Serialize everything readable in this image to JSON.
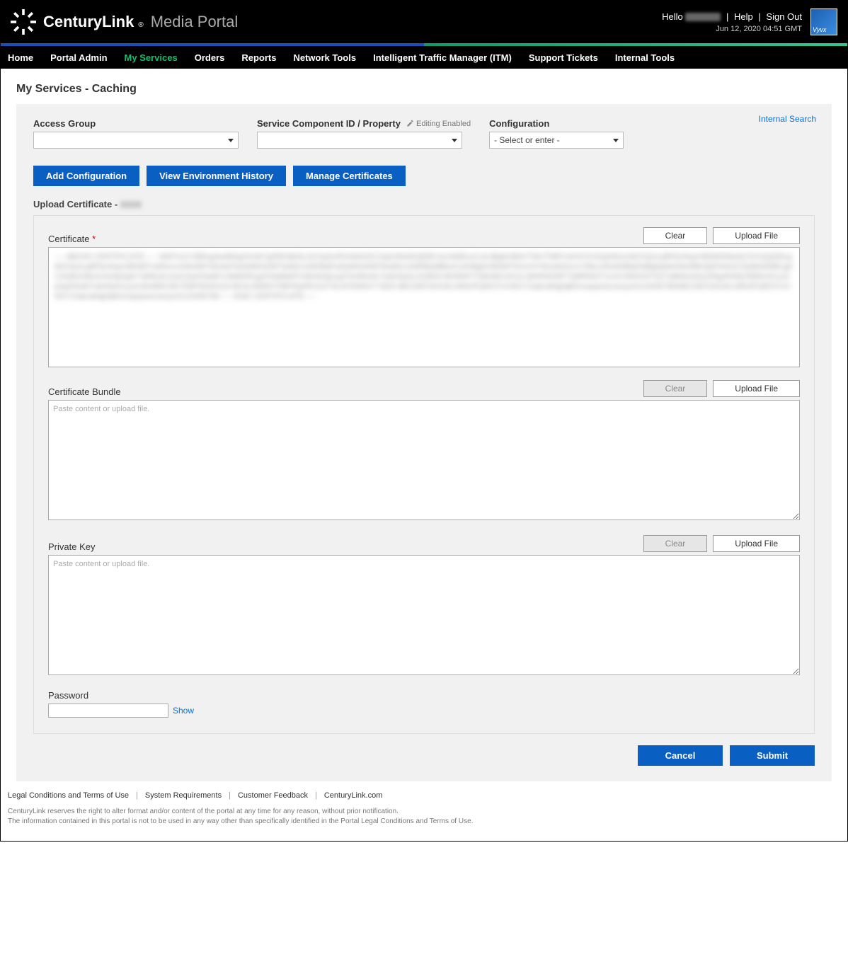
{
  "header": {
    "brand_bold": "CenturyLink",
    "brand_reg": "®",
    "brand_sub": "Media Portal",
    "hello": "Hello",
    "help": "Help",
    "signout": "Sign Out",
    "timestamp": "Jun 12, 2020 04:51 GMT",
    "vyvx": "Vyvx"
  },
  "nav": {
    "home": "Home",
    "portal_admin": "Portal Admin",
    "my_services": "My Services",
    "orders": "Orders",
    "reports": "Reports",
    "network_tools": "Network Tools",
    "itm": "Intelligent Traffic Manager (ITM)",
    "support": "Support Tickets",
    "internal": "Internal Tools"
  },
  "page": {
    "title": "My Services - Caching",
    "internal_search": "Internal Search"
  },
  "filters": {
    "access_group_label": "Access Group",
    "access_group_value": "                    ",
    "scid_label": "Service Component ID / Property",
    "scid_editing": "Editing Enabled",
    "scid_value": "            ",
    "config_label": "Configuration",
    "config_value": "- Select or enter -"
  },
  "buttons": {
    "add_config": "Add Configuration",
    "view_env": "View Environment History",
    "manage_certs": "Manage Certificates"
  },
  "upload": {
    "section_title": "Upload Certificate -",
    "cert_label": "Certificate",
    "bundle_label": "Certificate Bundle",
    "key_label": "Private Key",
    "password_label": "Password",
    "clear": "Clear",
    "upload_file": "Upload File",
    "placeholder": "Paste content or upload file.",
    "show": "Show",
    "cert_blur_content": "-----BEGIN CERTIFICATE-----\nMIIFXzCCBEegAwIBAgISA3k7g0f3H9jXkL0sTpQmR2vMA0GCSqGSIb3DQEBCwUAMEoxCzAJBgNVBAYTAlVTMRYwFAYDVQQKEw1MZXQncyBFbmNyeXB0MSMwIQYDVQQDExpMZXQncyBFbmNyeXB0IEF1dGhvcml0eSBYMzAeFw0yMDA2MTIwMzUxMDBaFw0yMDA5MTAwMzUxMDBaMBkxFzAVBgNVBAMTDmV4YW1wbGUuY29tLmNvMIIBIjANBgkqhkiG9w0BAQEFAAOCAQ8AMIIBCgKCAQEAr8k2m3n4p5q6r7s8t9u0v1w2x3y4z5a6b7c8d9e0f1g2h3i4j5k6l7m8n9o0p1q2r3s4t5u6v7w8x9y0z1A2B3C4D5E6F7G8H9I0J1K2L3M4N5O6P7Q8R9S0T1U2V3W4X5Y6Z7a8b9c0d1e2f3g4h5i6j7k8l9m0n1o2p3q4r5s6t7u8v9w0x1y2z3A4B5C6D7E8F9G0H1I2J3K4L5M6N7O8P9Q0R1S2T3U4V5W6X7Y8Z9\nABCDEFGHIJKLMNOPQRSTUVWXYZabcdefghijklmnopqrstuvwxyz0123456789ABCDEFGHIJKLMNOPQRSTUVWXYZabcdefghijklmnopqrstuvwxyz0123456789\n-----END CERTIFICATE-----"
  },
  "actions": {
    "cancel": "Cancel",
    "submit": "Submit"
  },
  "footer": {
    "legal": "Legal Conditions and Terms of Use",
    "sysreq": "System Requirements",
    "feedback": "Customer Feedback",
    "clcom": "CenturyLink.com",
    "disclaimer1": "CenturyLink reserves the right to alter format and/or content of the portal at any time for any reason, without prior notification.",
    "disclaimer2": "The information contained in this portal is not to be used in any way other than specifically identified in the Portal Legal Conditions and Terms of Use."
  }
}
